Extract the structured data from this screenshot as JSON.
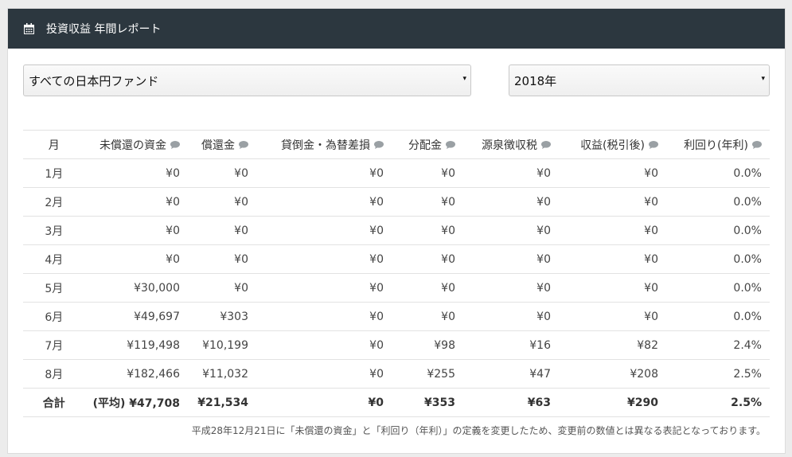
{
  "header": {
    "title": "投資収益 年間レポート",
    "icon": "calendar-icon"
  },
  "filters": {
    "fund": "すべての日本円ファンド",
    "year": "2018年",
    "arrow": "▾"
  },
  "table": {
    "columns": [
      "月",
      "未償還の資金",
      "償還金",
      "貸倒金・為替差損",
      "分配金",
      "源泉徴収税",
      "収益(税引後)",
      "利回り(年利)"
    ],
    "rows": [
      [
        "1月",
        "¥0",
        "¥0",
        "¥0",
        "¥0",
        "¥0",
        "¥0",
        "0.0%"
      ],
      [
        "2月",
        "¥0",
        "¥0",
        "¥0",
        "¥0",
        "¥0",
        "¥0",
        "0.0%"
      ],
      [
        "3月",
        "¥0",
        "¥0",
        "¥0",
        "¥0",
        "¥0",
        "¥0",
        "0.0%"
      ],
      [
        "4月",
        "¥0",
        "¥0",
        "¥0",
        "¥0",
        "¥0",
        "¥0",
        "0.0%"
      ],
      [
        "5月",
        "¥30,000",
        "¥0",
        "¥0",
        "¥0",
        "¥0",
        "¥0",
        "0.0%"
      ],
      [
        "6月",
        "¥49,697",
        "¥303",
        "¥0",
        "¥0",
        "¥0",
        "¥0",
        "0.0%"
      ],
      [
        "7月",
        "¥119,498",
        "¥10,199",
        "¥0",
        "¥98",
        "¥16",
        "¥82",
        "2.4%"
      ],
      [
        "8月",
        "¥182,466",
        "¥11,032",
        "¥0",
        "¥255",
        "¥47",
        "¥208",
        "2.5%"
      ]
    ],
    "total": [
      "合計",
      "(平均) ¥47,708",
      "¥21,534",
      "¥0",
      "¥353",
      "¥63",
      "¥290",
      "2.5%"
    ]
  },
  "note": "平成28年12月21日に「未償還の資金」と「利回り（年利）」の定義を変更したため、変更前の数値とは異なる表記となっております。"
}
